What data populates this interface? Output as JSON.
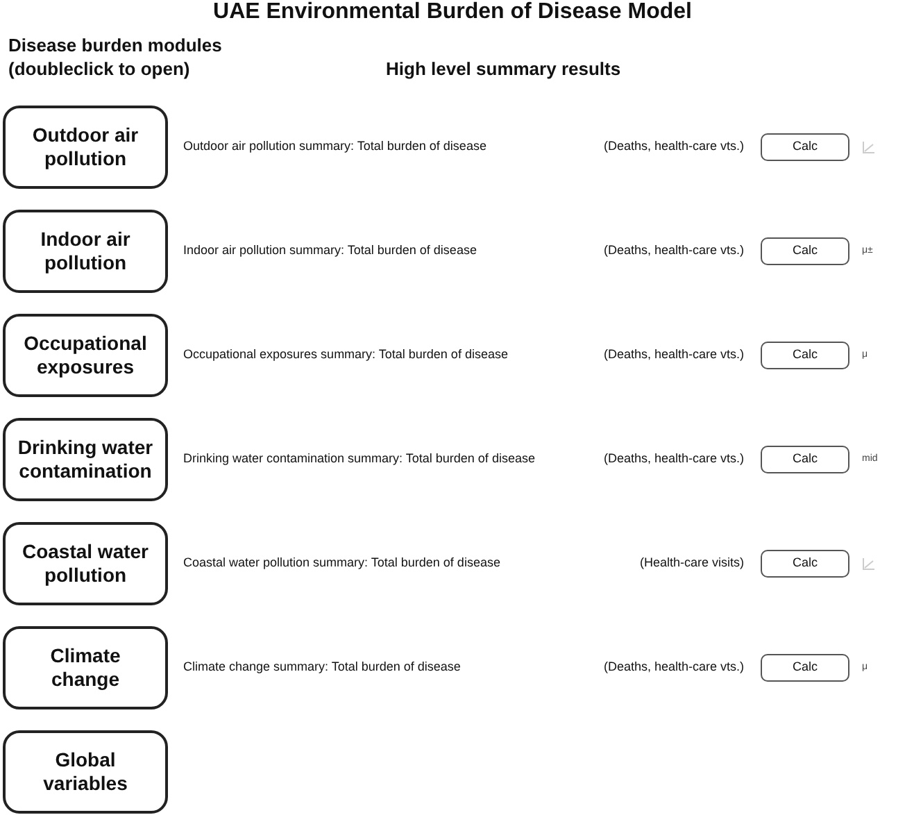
{
  "title": "UAE Environmental Burden of Disease Model",
  "modules_header": "Disease burden modules\n(doubleclick to open)",
  "results_header": "High level summary results",
  "modules": [
    {
      "label": "Outdoor air\npollution",
      "summary": "Outdoor air pollution summary: Total burden of disease",
      "measure": "(Deaths, health-care vts.)",
      "button": "Calc",
      "extra": {
        "kind": "icon"
      }
    },
    {
      "label": "Indoor air\npollution",
      "summary": "Indoor air pollution summary: Total burden of disease",
      "measure": "(Deaths, health-care vts.)",
      "button": "Calc",
      "extra": {
        "kind": "text",
        "text": "μ±"
      }
    },
    {
      "label": "Occupational\nexposures",
      "summary": "Occupational exposures summary: Total burden of disease",
      "measure": "(Deaths, health-care vts.)",
      "button": "Calc",
      "extra": {
        "kind": "text",
        "text": "μ"
      }
    },
    {
      "label": "Drinking water\ncontamination",
      "summary": "Drinking water contamination summary: Total burden of disease",
      "measure": "(Deaths, health-care vts.)",
      "button": "Calc",
      "extra": {
        "kind": "text",
        "text": "mid"
      }
    },
    {
      "label": "Coastal water\npollution",
      "summary": "Coastal water pollution summary: Total burden of disease",
      "measure": "(Health-care visits)",
      "button": "Calc",
      "extra": {
        "kind": "icon"
      }
    },
    {
      "label": "Climate\nchange",
      "summary": "Climate change summary: Total burden of disease",
      "measure": "(Deaths, health-care vts.)",
      "button": "Calc",
      "extra": {
        "kind": "text",
        "text": "μ"
      }
    },
    {
      "label": "Global\nvariables"
    }
  ]
}
